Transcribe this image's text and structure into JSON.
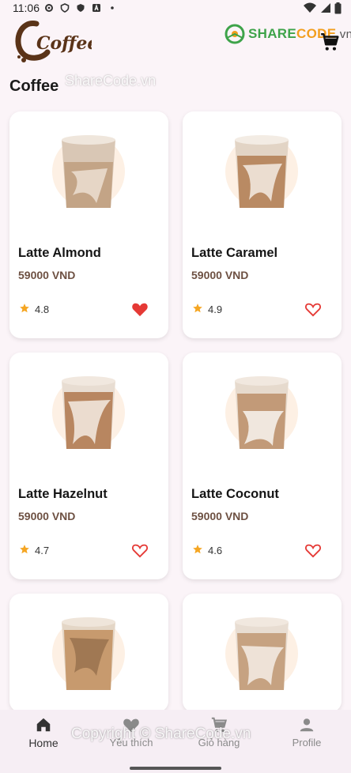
{
  "status_bar": {
    "time": "11:06"
  },
  "header": {
    "logo_text": "Coffee",
    "watermark": {
      "share": "SHARE",
      "code": "CODE",
      "domain": ".vn"
    }
  },
  "section": {
    "title": "Coffee",
    "watermark": "ShareCode.vn"
  },
  "products": [
    {
      "name": "Latte Almond",
      "price": "59000 VND",
      "rating": "4.8",
      "favorite": true
    },
    {
      "name": "Latte Caramel",
      "price": "59000 VND",
      "rating": "4.9",
      "favorite": false
    },
    {
      "name": "Latte Hazelnut",
      "price": "59000 VND",
      "rating": "4.7",
      "favorite": false
    },
    {
      "name": "Latte Coconut",
      "price": "59000 VND",
      "rating": "4.6",
      "favorite": false
    },
    {
      "name": "",
      "price": "",
      "rating": "",
      "favorite": false
    },
    {
      "name": "",
      "price": "",
      "rating": "",
      "favorite": false
    }
  ],
  "nav": {
    "items": [
      {
        "label": "Home",
        "icon": "home-icon",
        "active": true
      },
      {
        "label": "Yêu thích",
        "icon": "heart-icon",
        "active": false
      },
      {
        "label": "Giỏ hàng",
        "icon": "cart-icon",
        "active": false
      },
      {
        "label": "Profile",
        "icon": "person-icon",
        "active": false
      }
    ]
  },
  "footer_watermark": "Copyright © ShareCode.vn",
  "colors": {
    "accent_heart": "#e53935",
    "star": "#f5a623",
    "price": "#6d5042",
    "background": "#fbf4f8"
  }
}
